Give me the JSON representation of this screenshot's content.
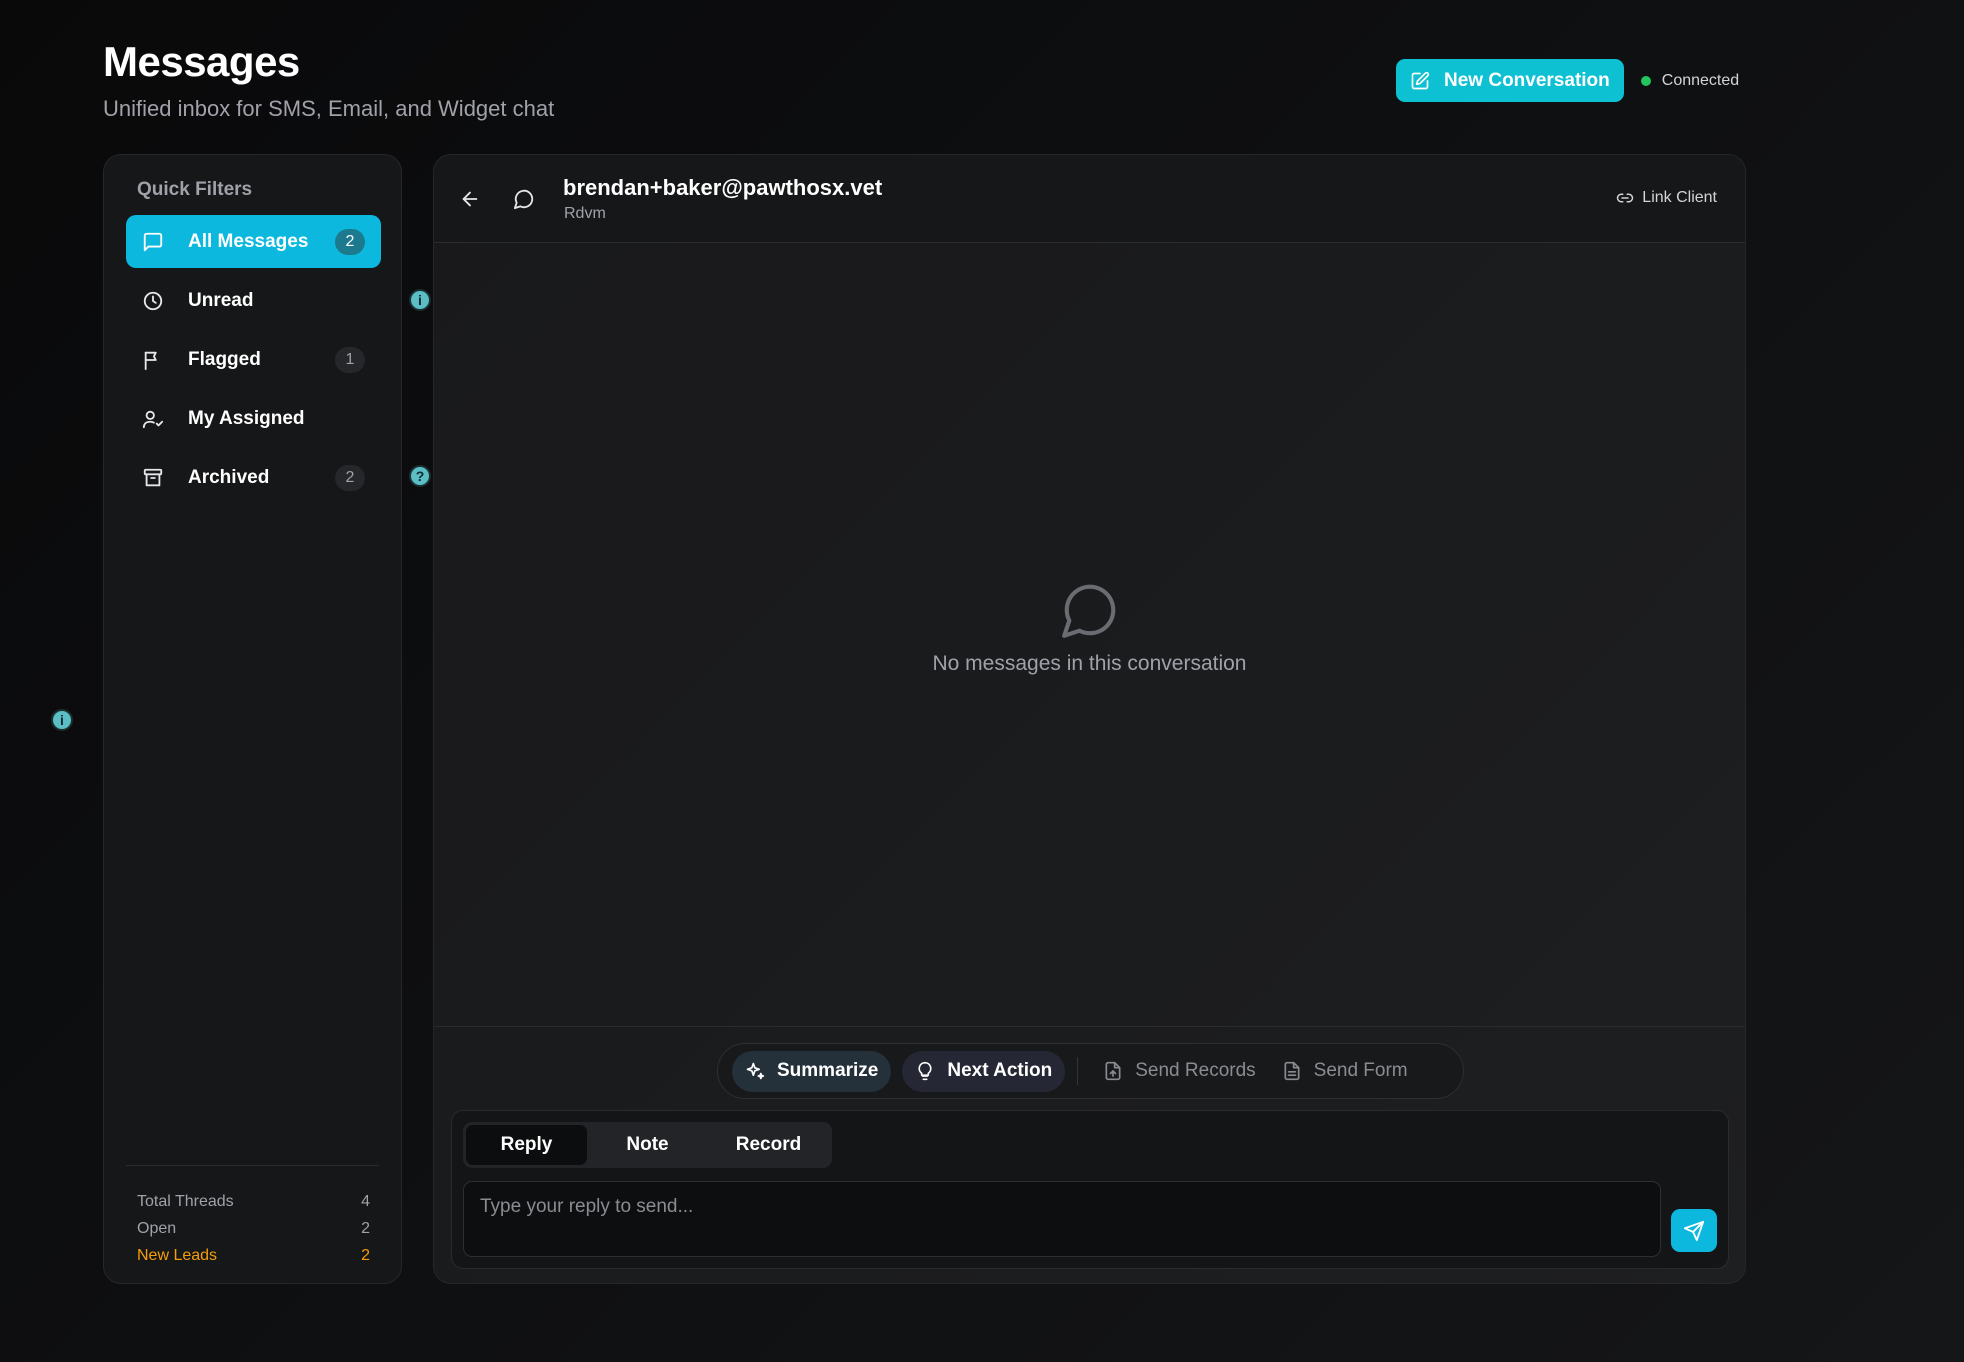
{
  "header": {
    "title": "Messages",
    "subtitle": "Unified inbox for SMS, Email, and Widget chat",
    "new_conversation_label": "New Conversation",
    "status_label": "Connected",
    "status_color": "#22c55e"
  },
  "sidebar": {
    "heading": "Quick Filters",
    "items": [
      {
        "label": "All Messages",
        "count": "2",
        "icon": "chat-bubble-icon",
        "active": true
      },
      {
        "label": "Unread",
        "count": "",
        "icon": "clock-icon"
      },
      {
        "label": "Flagged",
        "count": "1",
        "icon": "flag-icon"
      },
      {
        "label": "My Assigned",
        "count": "",
        "icon": "user-check-icon"
      },
      {
        "label": "Archived",
        "count": "2",
        "icon": "archive-icon"
      }
    ],
    "stats": [
      {
        "label": "Total Threads",
        "value": "4"
      },
      {
        "label": "Open",
        "value": "2"
      },
      {
        "label": "New Leads",
        "value": "2"
      }
    ]
  },
  "hints": {
    "info": "i",
    "help": "?"
  },
  "conversation": {
    "contact_email": "brendan+baker@pawthosx.vet",
    "contact_sub": "Rdvm",
    "link_client_label": "Link Client",
    "empty_text": "No messages in this conversation"
  },
  "actions": {
    "summarize": "Summarize",
    "next_action": "Next Action",
    "send_records": "Send Records",
    "send_form": "Send Form"
  },
  "composer": {
    "tabs": [
      "Reply",
      "Note",
      "Record"
    ],
    "active_tab": "Reply",
    "placeholder": "Type your reply to send..."
  },
  "colors": {
    "accent": "#0cb8de",
    "lead": "#f59e0b",
    "background": "#0b0b0c"
  }
}
